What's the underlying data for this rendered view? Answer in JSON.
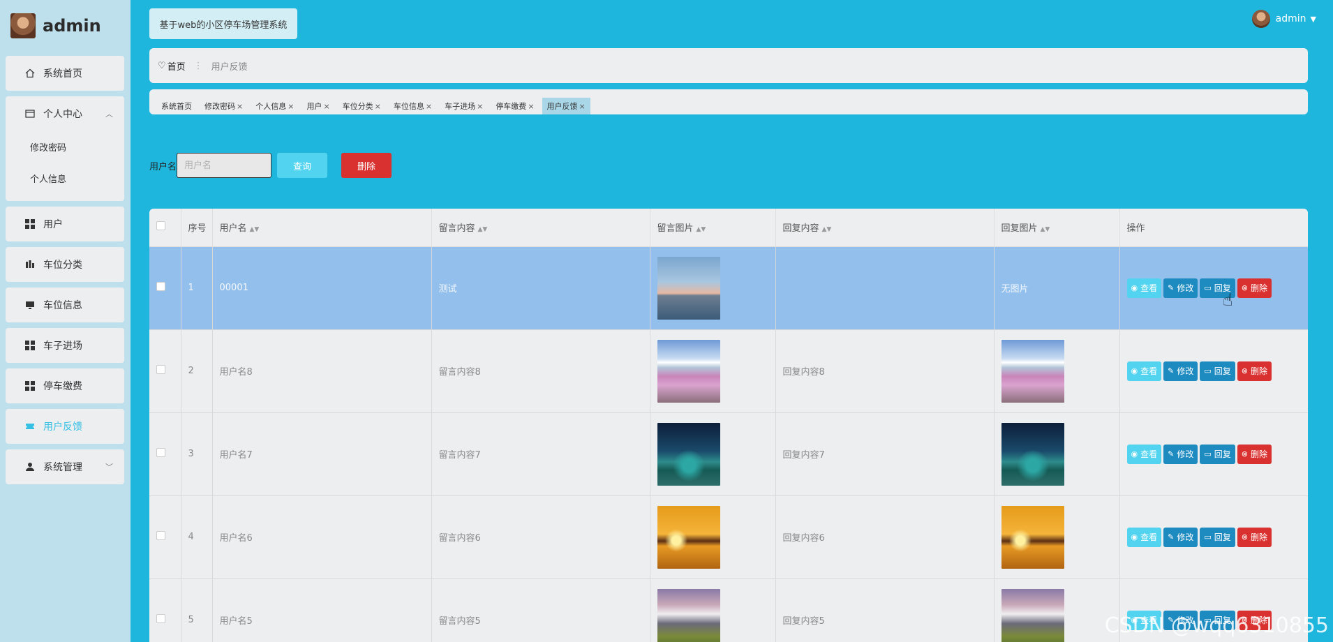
{
  "app": {
    "user_name": "admin",
    "system_title": "基于web的小区停车场管理系统",
    "top_user": "admin"
  },
  "sidebar": {
    "items": [
      {
        "label": "系统首页",
        "icon": "home-icon"
      },
      {
        "label": "个人中心",
        "icon": "card-icon",
        "expanded": true,
        "children": [
          {
            "label": "修改密码"
          },
          {
            "label": "个人信息"
          }
        ]
      },
      {
        "label": "用户",
        "icon": "grid-icon"
      },
      {
        "label": "车位分类",
        "icon": "chart-icon"
      },
      {
        "label": "车位信息",
        "icon": "monitor-icon"
      },
      {
        "label": "车子进场",
        "icon": "grid-icon"
      },
      {
        "label": "停车缴费",
        "icon": "grid-icon"
      },
      {
        "label": "用户反馈",
        "icon": "ticket-icon",
        "active": true
      },
      {
        "label": "系统管理",
        "icon": "person-icon"
      }
    ]
  },
  "breadcrumb": {
    "home": "首页",
    "current": "用户反馈"
  },
  "tags": [
    {
      "label": "系统首页",
      "closable": false
    },
    {
      "label": "修改密码",
      "closable": true
    },
    {
      "label": "个人信息",
      "closable": true
    },
    {
      "label": "用户",
      "closable": true
    },
    {
      "label": "车位分类",
      "closable": true
    },
    {
      "label": "车位信息",
      "closable": true
    },
    {
      "label": "车子进场",
      "closable": true
    },
    {
      "label": "停车缴费",
      "closable": true
    },
    {
      "label": "用户反馈",
      "closable": true,
      "active": true
    }
  ],
  "search": {
    "label": "用户名",
    "placeholder": "用户名",
    "query_button": "查询",
    "delete_button": "删除"
  },
  "table": {
    "headers": [
      "序号",
      "用户名",
      "留言内容",
      "留言图片",
      "回复内容",
      "回复图片",
      "操作"
    ],
    "rows": [
      {
        "index": "1",
        "username": "00001",
        "content": "测试",
        "image": "lake",
        "reply": "",
        "reply_image": "",
        "reply_image_text": "无图片",
        "selected": true
      },
      {
        "index": "2",
        "username": "用户名8",
        "content": "留言内容8",
        "image": "fuji",
        "reply": "回复内容8",
        "reply_image": "fuji",
        "reply_image_text": ""
      },
      {
        "index": "3",
        "username": "用户名7",
        "content": "留言内容7",
        "image": "night",
        "reply": "回复内容7",
        "reply_image": "night",
        "reply_image_text": ""
      },
      {
        "index": "4",
        "username": "用户名6",
        "content": "留言内容6",
        "image": "sunset",
        "reply": "回复内容6",
        "reply_image": "sunset",
        "reply_image_text": ""
      },
      {
        "index": "5",
        "username": "用户名5",
        "content": "留言内容5",
        "image": "mount",
        "reply": "回复内容5",
        "reply_image": "mount",
        "reply_image_text": ""
      }
    ],
    "actions": {
      "view": "查看",
      "edit": "修改",
      "reply": "回复",
      "delete": "删除"
    }
  },
  "watermark": "CSDN @wqq6310855",
  "colors": {
    "accent": "#1fb6dd",
    "danger": "#d9312f",
    "primary": "#1d8ac0",
    "info": "#52d3f0",
    "selected_row": "#93bfec"
  }
}
